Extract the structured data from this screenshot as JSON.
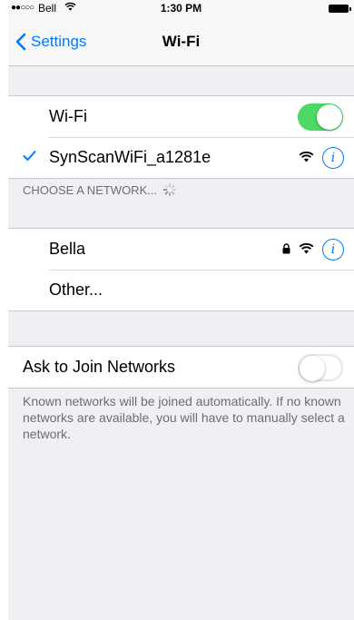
{
  "status_bar": {
    "signal": "●●○○○",
    "carrier": "Bell",
    "time": "1:30 PM",
    "wifi_icon": "wifi-icon",
    "battery_icon": "battery-full-icon"
  },
  "nav": {
    "back_label": "Settings",
    "title": "Wi-Fi"
  },
  "wifi_group": {
    "wifi_label": "Wi-Fi",
    "wifi_enabled": true,
    "connected_network": "SynScanWiFi_a1281e"
  },
  "networks": {
    "header": "CHOOSE A NETWORK...",
    "items": [
      {
        "name": "Bella",
        "secured": true
      },
      {
        "name": "Other..."
      }
    ]
  },
  "ask_join": {
    "label": "Ask to Join Networks",
    "enabled": false,
    "footer": "Known networks will be joined automatically. If no known networks are available, you will have to manually select a network."
  },
  "colors": {
    "accent": "#007aff",
    "toggle_on": "#4cd964",
    "background": "#efeff4"
  }
}
